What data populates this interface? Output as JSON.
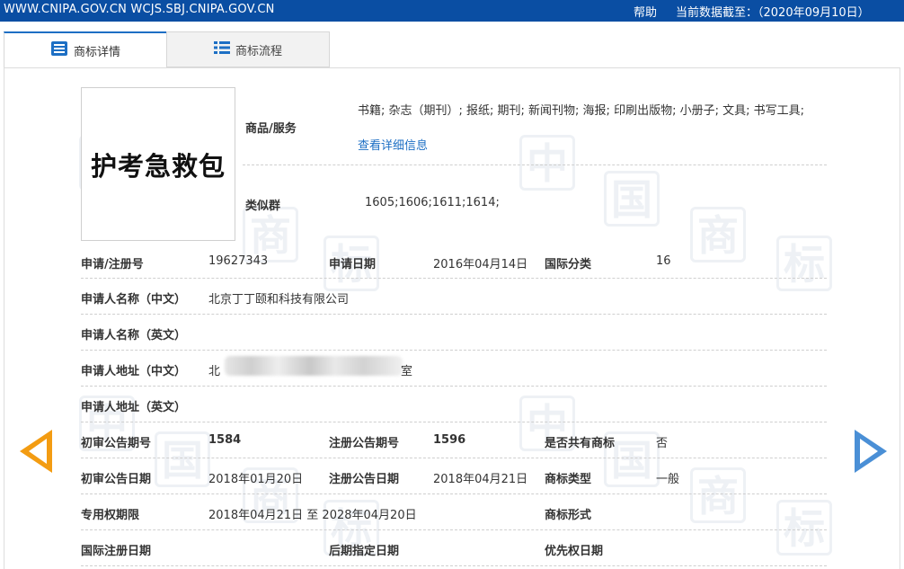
{
  "header": {
    "site": "WWW.CNIPA.GOV.CN WCJS.SBJ.CNIPA.GOV.CN",
    "help": "帮助",
    "data_date": "当前数据截至：（2020年09月10日）"
  },
  "tabs": [
    {
      "label": "商标详情",
      "icon": "list-icon"
    },
    {
      "label": "商标流程",
      "icon": "grid-list-icon"
    }
  ],
  "watermark": {
    "char1": "中",
    "char2": "国",
    "char3": "商",
    "char4": "标"
  },
  "mark": {
    "text": "护考急救包"
  },
  "goods": {
    "label": "商品/服务",
    "value": "书籍; 杂志（期刊）; 报纸; 期刊; 新闻刊物; 海报; 印刷出版物; 小册子; 文具; 书写工具;",
    "detail_link": "查看详细信息"
  },
  "similar": {
    "label": "类似群",
    "value": "1605;1606;1611;1614;"
  },
  "details": {
    "reg_no_label": "申请/注册号",
    "reg_no": "19627343",
    "apply_date_label": "申请日期",
    "apply_date": "2016年04月14日",
    "intl_class_label": "国际分类",
    "intl_class": "16",
    "applicant_cn_label": "申请人名称（中文）",
    "applicant_cn": "北京丁丁颐和科技有限公司",
    "applicant_en_label": "申请人名称（英文）",
    "address_cn_label": "申请人地址（中文）",
    "address_cn_start": "北",
    "address_cn_end": "室",
    "address_en_label": "申请人地址（英文）",
    "prelim_no_label": "初审公告期号",
    "prelim_no": "1584",
    "reg_ann_no_label": "注册公告期号",
    "reg_ann_no": "1596",
    "shared_label": "是否共有商标",
    "shared": "否",
    "prelim_date_label": "初审公告日期",
    "prelim_date": "2018年01月20日",
    "reg_ann_date_label": "注册公告日期",
    "reg_ann_date": "2018年04月21日",
    "type_label": "商标类型",
    "type": "一般",
    "exclusive_label": "专用权期限",
    "exclusive": "2018年04月21日 至 2028年04月20日",
    "form_label": "商标形式",
    "intl_reg_date_label": "国际注册日期",
    "later_date_label": "后期指定日期",
    "priority_label": "优先权日期"
  },
  "colors": {
    "topbar": "#0a4ea3",
    "link": "#1d6fc4",
    "prev_arrow": "#f39c12",
    "next_arrow": "#4a8fd6"
  }
}
